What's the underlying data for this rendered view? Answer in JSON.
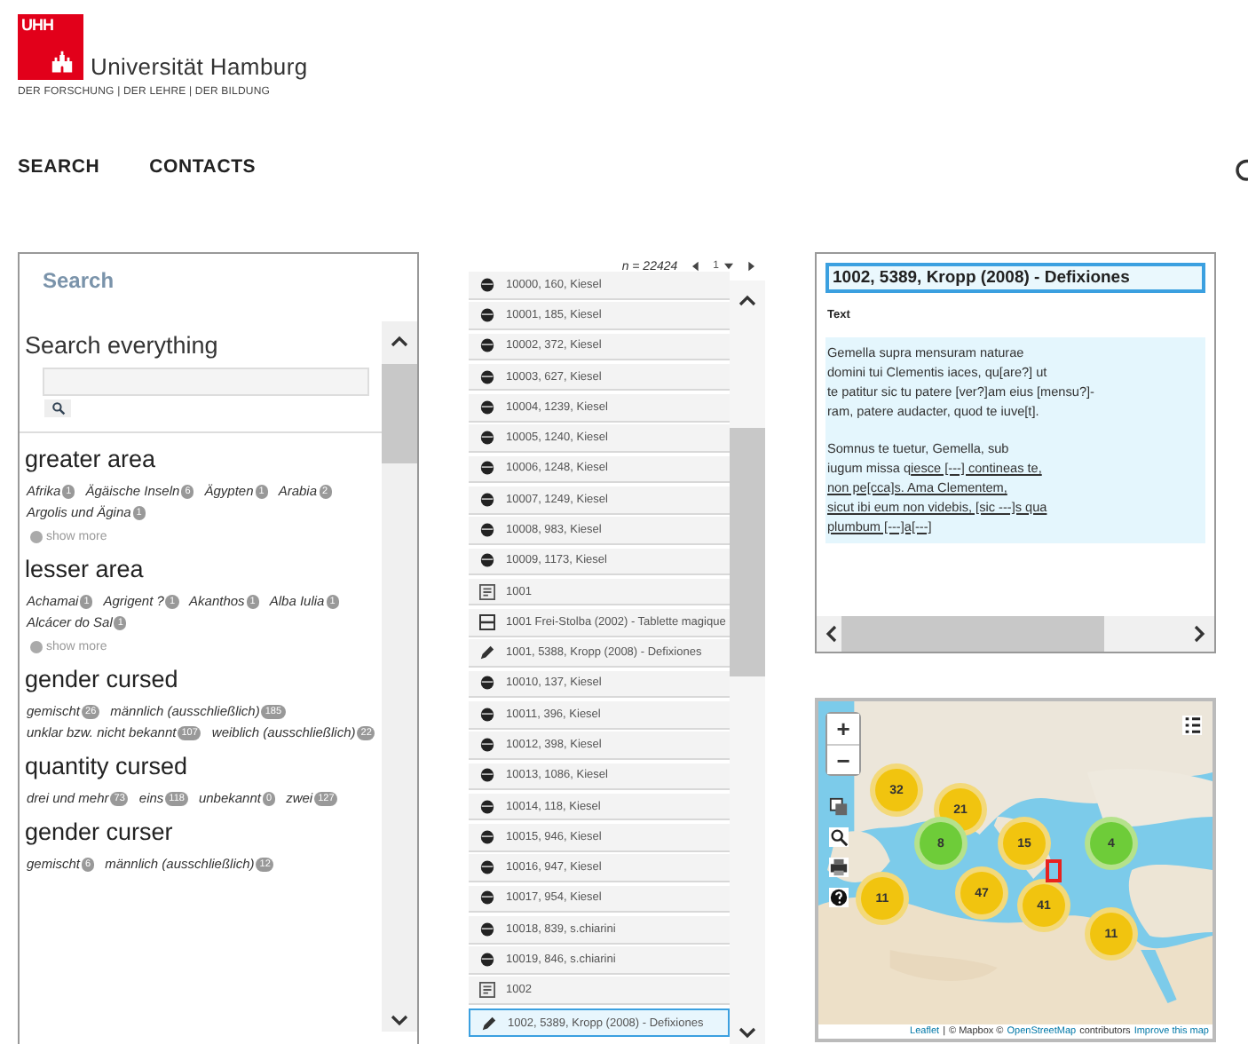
{
  "header": {
    "logo_mark": "UHH",
    "university": "Universität Hamburg",
    "tagline": "DER FORSCHUNG | DER LEHRE | DER BILDUNG"
  },
  "nav": [
    {
      "label": "SEARCH"
    },
    {
      "label": "CONTACTS"
    }
  ],
  "search_panel": {
    "title": "Search",
    "search_label": "Search everything",
    "facets": [
      {
        "title": "greater area",
        "values": [
          {
            "label": "Afrika",
            "count": "1"
          },
          {
            "label": "Ägäische Inseln",
            "count": "6"
          },
          {
            "label": "Ägypten",
            "count": "1"
          },
          {
            "label": "Arabia",
            "count": "2"
          },
          {
            "label": "Argolis und Ägina",
            "count": "1"
          }
        ],
        "more": "show more"
      },
      {
        "title": "lesser area",
        "values": [
          {
            "label": "Achamai",
            "count": "1"
          },
          {
            "label": "Agrigent ?",
            "count": "1"
          },
          {
            "label": "Akanthos",
            "count": "1"
          },
          {
            "label": "Alba Iulia",
            "count": "1"
          },
          {
            "label": "Alcácer do Sal",
            "count": "1"
          }
        ],
        "more": "show more"
      },
      {
        "title": "gender cursed",
        "values": [
          {
            "label": "gemischt",
            "count": "26"
          },
          {
            "label": "männlich (ausschließlich)",
            "count": "185"
          },
          {
            "label": "unklar bzw. nicht bekannt",
            "count": "107"
          },
          {
            "label": "weiblich (ausschließlich)",
            "count": "22"
          }
        ]
      },
      {
        "title": "quantity cursed",
        "values": [
          {
            "label": "drei und mehr",
            "count": "73"
          },
          {
            "label": "eins",
            "count": "118"
          },
          {
            "label": "unbekannt",
            "count": "0"
          },
          {
            "label": "zwei",
            "count": "127"
          }
        ]
      },
      {
        "title": "gender curser",
        "values": [
          {
            "label": "gemischt",
            "count": "6"
          },
          {
            "label": "männlich (ausschließlich)",
            "count": "12"
          }
        ]
      }
    ]
  },
  "results": {
    "count": "n = 22424",
    "page": "1",
    "rows": [
      {
        "kind": "object",
        "label": "10000, 160, Kiesel",
        "selected": false
      },
      {
        "kind": "object",
        "label": "10001, 185, Kiesel",
        "selected": false
      },
      {
        "kind": "object",
        "label": "10002, 372, Kiesel",
        "selected": false
      },
      {
        "kind": "object",
        "label": "10003, 627, Kiesel",
        "selected": false
      },
      {
        "kind": "object",
        "label": "10004, 1239, Kiesel",
        "selected": false
      },
      {
        "kind": "object",
        "label": "10005, 1240, Kiesel",
        "selected": false
      },
      {
        "kind": "object",
        "label": "10006, 1248, Kiesel",
        "selected": false
      },
      {
        "kind": "object",
        "label": "10007, 1249, Kiesel",
        "selected": false
      },
      {
        "kind": "object",
        "label": "10008, 983, Kiesel",
        "selected": false
      },
      {
        "kind": "object",
        "label": "10009, 1173, Kiesel",
        "selected": false
      },
      {
        "kind": "document",
        "label": "1001",
        "selected": false
      },
      {
        "kind": "edition",
        "label": "1001 Frei-Stolba (2002) - Tablette magique",
        "selected": false
      },
      {
        "kind": "reading",
        "label": "1001, 5388, Kropp (2008) - Defixiones",
        "selected": false
      },
      {
        "kind": "object",
        "label": "10010, 137, Kiesel",
        "selected": false
      },
      {
        "kind": "object",
        "label": "10011, 396, Kiesel",
        "selected": false
      },
      {
        "kind": "object",
        "label": "10012, 398, Kiesel",
        "selected": false
      },
      {
        "kind": "object",
        "label": "10013, 1086, Kiesel",
        "selected": false
      },
      {
        "kind": "object",
        "label": "10014, 118, Kiesel",
        "selected": false
      },
      {
        "kind": "object",
        "label": "10015, 946, Kiesel",
        "selected": false
      },
      {
        "kind": "object",
        "label": "10016, 947, Kiesel",
        "selected": false
      },
      {
        "kind": "object",
        "label": "10017, 954, Kiesel",
        "selected": false
      },
      {
        "kind": "object",
        "label": "10018, 839, s.chiarini",
        "selected": false
      },
      {
        "kind": "object",
        "label": "10019, 846, s.chiarini",
        "selected": false
      },
      {
        "kind": "document",
        "label": "1002",
        "selected": false
      },
      {
        "kind": "reading",
        "label": "1002, 5389, Kropp (2008) - Defixiones",
        "selected": true
      }
    ]
  },
  "detail": {
    "title": "1002, 5389, Kropp (2008) - Defixiones",
    "section_label": "Text",
    "stanzas": [
      [
        [
          {
            "text": "Gemella supra mensuram naturae",
            "underlined": false
          }
        ],
        [
          {
            "text": "domini tui Clementis iaces, qu[are?] ut",
            "underlined": false
          }
        ],
        [
          {
            "text": "te patitur sic tu patere [ver?]am eius [mensu?]-",
            "underlined": false
          }
        ],
        [
          {
            "text": "ram, patere audacter, quod te iuve[t].",
            "underlined": false
          }
        ]
      ],
      [
        [
          {
            "text": "Somnus te tuetur, Gemella, sub",
            "underlined": false
          }
        ],
        [
          {
            "text": "iugum missa q",
            "underlined": false
          },
          {
            "text": "iesce [---] contineas te,",
            "underlined": true
          }
        ],
        [
          {
            "text": "non pe[cca]s. Ama Clementem,",
            "underlined": true
          }
        ],
        [
          {
            "text": "sicut ibi eum non videbis, [sic ---]s qua",
            "underlined": true
          }
        ],
        [
          {
            "text": "plumbum [---]a[---]",
            "underlined": true
          }
        ]
      ]
    ]
  },
  "map": {
    "clusters": [
      {
        "count": "32",
        "kind": "many"
      },
      {
        "count": "21",
        "kind": "many"
      },
      {
        "count": "8",
        "kind": "few"
      },
      {
        "count": "15",
        "kind": "many"
      },
      {
        "count": "4",
        "kind": "few"
      },
      {
        "count": "11",
        "kind": "many"
      },
      {
        "count": "47",
        "kind": "many"
      },
      {
        "count": "41",
        "kind": "many"
      },
      {
        "count": "11",
        "kind": "many"
      }
    ],
    "zoom_in": "+",
    "zoom_out": "−",
    "attribution": [
      {
        "text": "Leaflet",
        "link": true
      },
      {
        "text": "|",
        "link": false
      },
      {
        "text": "© Mapbox ©",
        "link": false
      },
      {
        "text": "OpenStreetMap",
        "link": true
      },
      {
        "text": "contributors",
        "link": false
      },
      {
        "text": "Improve this map",
        "link": true
      }
    ]
  }
}
